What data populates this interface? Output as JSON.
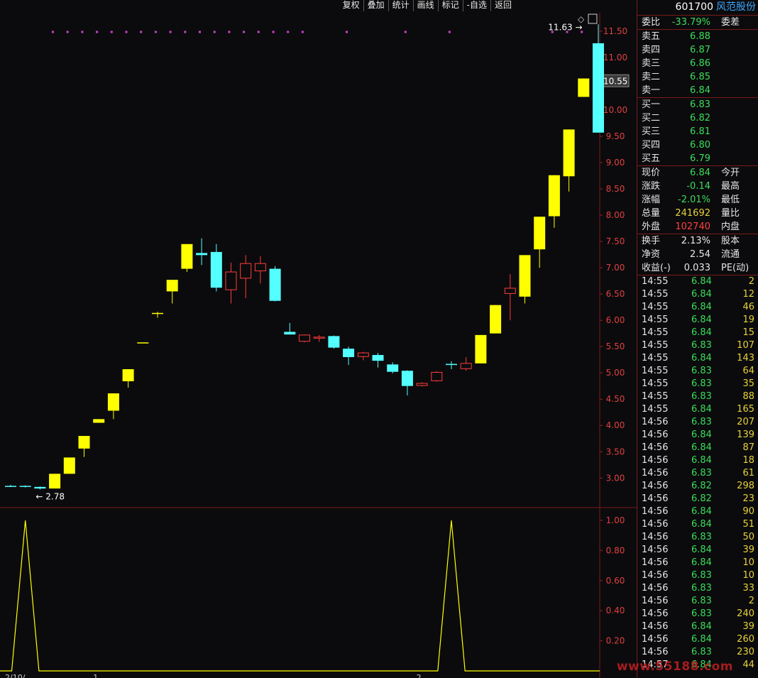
{
  "toolbar": {
    "items": [
      "复权",
      "叠加",
      "统计",
      "画线",
      "标记",
      "-自选",
      "返回"
    ]
  },
  "header": {
    "code": "601700",
    "name": "风范股份"
  },
  "panel": {
    "weibi": {
      "label": "委比",
      "value": "-33.79%",
      "extra": "委差"
    },
    "asks": [
      {
        "label": "卖五",
        "price": "6.88"
      },
      {
        "label": "卖四",
        "price": "6.87"
      },
      {
        "label": "卖三",
        "price": "6.86"
      },
      {
        "label": "卖二",
        "price": "6.85"
      },
      {
        "label": "卖一",
        "price": "6.84"
      }
    ],
    "bids": [
      {
        "label": "买一",
        "price": "6.83"
      },
      {
        "label": "买二",
        "price": "6.82"
      },
      {
        "label": "买三",
        "price": "6.81"
      },
      {
        "label": "买四",
        "price": "6.80"
      },
      {
        "label": "买五",
        "price": "6.79"
      }
    ],
    "stats1": [
      {
        "label": "现价",
        "value": "6.84",
        "color": "green",
        "extra": "今开"
      },
      {
        "label": "涨跌",
        "value": "-0.14",
        "color": "green",
        "extra": "最高"
      },
      {
        "label": "涨幅",
        "value": "-2.01%",
        "color": "green",
        "extra": "最低"
      },
      {
        "label": "总量",
        "value": "241692",
        "color": "yellow",
        "extra": "量比"
      },
      {
        "label": "外盘",
        "value": "102740",
        "color": "red",
        "extra": "内盘"
      }
    ],
    "stats2": [
      {
        "label": "换手",
        "value": "2.13%",
        "color": "white",
        "extra": "股本"
      },
      {
        "label": "净资",
        "value": "2.54",
        "color": "white",
        "extra": "流通"
      },
      {
        "label": "收益(-)",
        "value": "0.033",
        "color": "white",
        "extra": "PE(动)"
      }
    ],
    "ticks": [
      [
        "14:55",
        "6.84",
        "2"
      ],
      [
        "14:55",
        "6.84",
        "12"
      ],
      [
        "14:55",
        "6.84",
        "46"
      ],
      [
        "14:55",
        "6.84",
        "19"
      ],
      [
        "14:55",
        "6.84",
        "15"
      ],
      [
        "14:55",
        "6.83",
        "107"
      ],
      [
        "14:55",
        "6.84",
        "143"
      ],
      [
        "14:55",
        "6.83",
        "64"
      ],
      [
        "14:55",
        "6.83",
        "35"
      ],
      [
        "14:55",
        "6.83",
        "88"
      ],
      [
        "14:55",
        "6.84",
        "165"
      ],
      [
        "14:56",
        "6.83",
        "207"
      ],
      [
        "14:56",
        "6.84",
        "139"
      ],
      [
        "14:56",
        "6.84",
        "87"
      ],
      [
        "14:56",
        "6.84",
        "18"
      ],
      [
        "14:56",
        "6.83",
        "61"
      ],
      [
        "14:56",
        "6.82",
        "298"
      ],
      [
        "14:56",
        "6.82",
        "23"
      ],
      [
        "14:56",
        "6.84",
        "90"
      ],
      [
        "14:56",
        "6.84",
        "51"
      ],
      [
        "14:56",
        "6.83",
        "50"
      ],
      [
        "14:56",
        "6.84",
        "39"
      ],
      [
        "14:56",
        "6.84",
        "10"
      ],
      [
        "14:56",
        "6.83",
        "10"
      ],
      [
        "14:56",
        "6.83",
        "33"
      ],
      [
        "14:56",
        "6.83",
        "2"
      ],
      [
        "14:56",
        "6.83",
        "240"
      ],
      [
        "14:56",
        "6.84",
        "39"
      ],
      [
        "14:56",
        "6.84",
        "260"
      ],
      [
        "14:56",
        "6.83",
        "230"
      ],
      [
        "14:57",
        "6.84",
        "44"
      ]
    ],
    "watermark": "www.55188.com"
  },
  "chart_data": {
    "type": "candlestick",
    "yticks": [
      "11.50",
      "11.00",
      "10.50",
      "10.00",
      "9.50",
      "9.00",
      "8.50",
      "8.00",
      "7.50",
      "7.00",
      "6.50",
      "6.00",
      "5.50",
      "5.00",
      "4.50",
      "4.00",
      "3.50",
      "3.00"
    ],
    "ylim": [
      2.45,
      11.85
    ],
    "price_marker": "10.55",
    "annotations": [
      {
        "text": "11.63",
        "x_index": 39,
        "y": 11.63
      },
      {
        "text": "2.78",
        "x_index": 2,
        "y": 2.78
      }
    ],
    "candles": [
      {
        "o": 2.85,
        "h": 2.87,
        "l": 2.83,
        "c": 2.85,
        "cls": "flat"
      },
      {
        "o": 2.85,
        "h": 2.86,
        "l": 2.82,
        "c": 2.83,
        "cls": "down"
      },
      {
        "o": 2.83,
        "h": 2.84,
        "l": 2.78,
        "c": 2.8,
        "cls": "down"
      },
      {
        "o": 2.8,
        "h": 3.08,
        "l": 2.8,
        "c": 3.08,
        "cls": "limit"
      },
      {
        "o": 3.08,
        "h": 3.39,
        "l": 3.08,
        "c": 3.39,
        "cls": "limit"
      },
      {
        "o": 3.56,
        "h": 3.8,
        "l": 3.4,
        "c": 3.8,
        "cls": "limit"
      },
      {
        "o": 4.05,
        "h": 4.12,
        "l": 4.05,
        "c": 4.12,
        "cls": "limit"
      },
      {
        "o": 4.28,
        "h": 4.61,
        "l": 4.12,
        "c": 4.61,
        "cls": "limit"
      },
      {
        "o": 4.84,
        "h": 5.07,
        "l": 4.72,
        "c": 5.07,
        "cls": "limit"
      },
      {
        "o": 5.58,
        "h": 5.58,
        "l": 5.58,
        "c": 5.58,
        "cls": "limit"
      },
      {
        "o": 6.14,
        "h": 6.16,
        "l": 6.05,
        "c": 6.14,
        "cls": "limit"
      },
      {
        "o": 6.55,
        "h": 6.77,
        "l": 6.32,
        "c": 6.77,
        "cls": "limit"
      },
      {
        "o": 6.98,
        "h": 7.45,
        "l": 6.92,
        "c": 7.45,
        "cls": "limit"
      },
      {
        "o": 7.28,
        "h": 7.56,
        "l": 7.05,
        "c": 7.24,
        "cls": "down"
      },
      {
        "o": 7.3,
        "h": 7.45,
        "l": 6.55,
        "c": 6.62,
        "cls": "down"
      },
      {
        "o": 6.58,
        "h": 7.1,
        "l": 6.32,
        "c": 6.92,
        "cls": "up"
      },
      {
        "o": 6.8,
        "h": 7.24,
        "l": 6.42,
        "c": 7.08,
        "cls": "up"
      },
      {
        "o": 6.94,
        "h": 7.22,
        "l": 6.7,
        "c": 7.08,
        "cls": "up"
      },
      {
        "o": 6.98,
        "h": 7.03,
        "l": 6.36,
        "c": 6.37,
        "cls": "down"
      },
      {
        "o": 5.78,
        "h": 5.95,
        "l": 5.73,
        "c": 5.73,
        "cls": "down"
      },
      {
        "o": 5.6,
        "h": 5.73,
        "l": 5.58,
        "c": 5.72,
        "cls": "up"
      },
      {
        "o": 5.66,
        "h": 5.72,
        "l": 5.59,
        "c": 5.68,
        "cls": "up"
      },
      {
        "o": 5.7,
        "h": 5.71,
        "l": 5.46,
        "c": 5.48,
        "cls": "down"
      },
      {
        "o": 5.46,
        "h": 5.5,
        "l": 5.15,
        "c": 5.3,
        "cls": "down"
      },
      {
        "o": 5.31,
        "h": 5.4,
        "l": 5.24,
        "c": 5.38,
        "cls": "up"
      },
      {
        "o": 5.34,
        "h": 5.38,
        "l": 5.1,
        "c": 5.23,
        "cls": "down"
      },
      {
        "o": 5.16,
        "h": 5.2,
        "l": 4.99,
        "c": 5.02,
        "cls": "down"
      },
      {
        "o": 5.04,
        "h": 5.05,
        "l": 4.57,
        "c": 4.75,
        "cls": "down"
      },
      {
        "o": 4.76,
        "h": 4.82,
        "l": 4.74,
        "c": 4.8,
        "cls": "up"
      },
      {
        "o": 4.85,
        "h": 5.03,
        "l": 4.83,
        "c": 5.01,
        "cls": "up"
      },
      {
        "o": 5.17,
        "h": 5.22,
        "l": 5.07,
        "c": 5.17,
        "cls": "down"
      },
      {
        "o": 5.08,
        "h": 5.3,
        "l": 5.04,
        "c": 5.18,
        "cls": "up"
      },
      {
        "o": 5.18,
        "h": 5.72,
        "l": 5.18,
        "c": 5.72,
        "cls": "limit"
      },
      {
        "o": 5.75,
        "h": 6.29,
        "l": 5.75,
        "c": 6.29,
        "cls": "limit"
      },
      {
        "o": 6.51,
        "h": 6.88,
        "l": 6.0,
        "c": 6.61,
        "cls": "up"
      },
      {
        "o": 6.45,
        "h": 7.24,
        "l": 6.32,
        "c": 7.24,
        "cls": "limit"
      },
      {
        "o": 7.35,
        "h": 7.97,
        "l": 7.0,
        "c": 7.97,
        "cls": "limit"
      },
      {
        "o": 7.98,
        "h": 8.76,
        "l": 7.76,
        "c": 8.76,
        "cls": "limit"
      },
      {
        "o": 8.74,
        "h": 9.63,
        "l": 8.45,
        "c": 9.63,
        "cls": "limit"
      },
      {
        "o": 10.25,
        "h": 10.6,
        "l": 10.25,
        "c": 10.6,
        "cls": "limit"
      },
      {
        "o": 11.27,
        "h": 11.63,
        "l": 9.57,
        "c": 9.57,
        "cls": "down"
      }
    ],
    "indicator": {
      "yticks": [
        "1.00",
        "0.80",
        "0.60",
        "0.40",
        "0.20"
      ],
      "ylim": [
        0,
        1.08
      ],
      "values": [
        0,
        1,
        0,
        0,
        0,
        0,
        0,
        0,
        0,
        0,
        0,
        0,
        0,
        0,
        0,
        0,
        0,
        0,
        0,
        0,
        0,
        0,
        0,
        0,
        0,
        0,
        0,
        0,
        0,
        0,
        1,
        0,
        0,
        0,
        0,
        0,
        0,
        0,
        0,
        0,
        0
      ]
    },
    "xlabels": [
      {
        "text": "2/10/",
        "x_index": 0
      },
      {
        "text": "1",
        "x_index": 6
      },
      {
        "text": "2",
        "x_index": 28
      }
    ]
  }
}
